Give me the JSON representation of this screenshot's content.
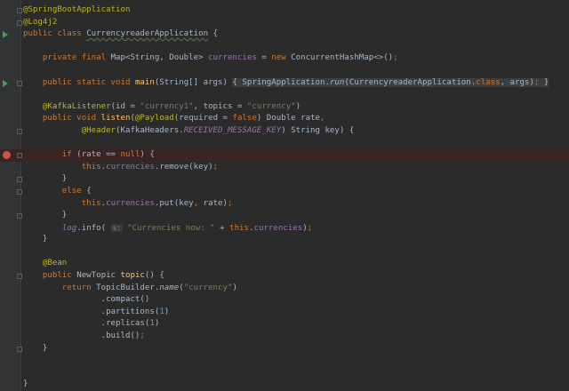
{
  "editor": {
    "colors": {
      "background": "#2b2b2b",
      "keyword": "#cc7832",
      "annotation": "#bbb529",
      "string": "#6a8759",
      "field": "#9876aa",
      "number": "#6897bb",
      "method": "#ffc66d",
      "text": "#a9b7c6",
      "breakpoint": "#c75450",
      "run": "#499c54"
    },
    "lines": [
      {
        "t": [
          [
            "@SpringBootApplication",
            "ann"
          ]
        ],
        "fold": true
      },
      {
        "t": [
          [
            "@Log4j2",
            "ann"
          ]
        ],
        "fold": true
      },
      {
        "t": [
          [
            "public class ",
            "kw"
          ],
          [
            "CurrencyreaderApplication",
            "sq"
          ],
          [
            " {",
            ""
          ]
        ],
        "run": true
      },
      {
        "t": []
      },
      {
        "t": [
          [
            "    private final ",
            "kw"
          ],
          [
            "Map<String, Double> ",
            ""
          ],
          [
            "currencies",
            "field"
          ],
          [
            " = ",
            ""
          ],
          [
            "new ",
            "kw"
          ],
          [
            "ConcurrentHashMap<>()",
            ""
          ],
          [
            ";",
            "kw"
          ]
        ]
      },
      {
        "t": []
      },
      {
        "t": [
          [
            "    public static void ",
            "kw"
          ],
          [
            "main",
            "fn"
          ],
          [
            "(String[] args) ",
            ""
          ],
          [
            "{ SpringApplication.",
            "fold"
          ],
          [
            "run",
            "fold it"
          ],
          [
            "(CurrencyreaderApplication.",
            "fold"
          ],
          [
            "class",
            "fold kw"
          ],
          [
            ", args)",
            "fold"
          ],
          [
            ";",
            "fold kw"
          ],
          [
            " }",
            "fold"
          ]
        ],
        "run": true,
        "fold": true
      },
      {
        "t": []
      },
      {
        "t": [
          [
            "    @KafkaListener",
            "ann"
          ],
          [
            "(id = ",
            ""
          ],
          [
            "\"currency1\"",
            "str"
          ],
          [
            ", topics = ",
            ""
          ],
          [
            "\"currency\"",
            "str"
          ],
          [
            ")",
            ""
          ]
        ]
      },
      {
        "t": [
          [
            "    public void ",
            "kw"
          ],
          [
            "listen",
            "fn"
          ],
          [
            "(",
            ""
          ],
          [
            "@Payload",
            "ann"
          ],
          [
            "(required = ",
            ""
          ],
          [
            "false",
            "kw"
          ],
          [
            ") Double rate",
            ""
          ],
          [
            ",",
            "kw"
          ]
        ]
      },
      {
        "t": [
          [
            "            @Header",
            "ann"
          ],
          [
            "(KafkaHeaders.",
            ""
          ],
          [
            "RECEIVED_MESSAGE_KEY",
            "itf"
          ],
          [
            ") String key) {",
            ""
          ]
        ],
        "fold": true
      },
      {
        "t": []
      },
      {
        "t": [
          [
            "        if ",
            "kw"
          ],
          [
            "(rate == ",
            ""
          ],
          [
            "null",
            "kw"
          ],
          [
            ") {",
            ""
          ]
        ],
        "bp": true,
        "fold": true
      },
      {
        "t": [
          [
            "            this",
            "kw"
          ],
          [
            ".",
            ""
          ],
          [
            "currencies",
            "field"
          ],
          [
            ".remove(key)",
            ""
          ],
          [
            ";",
            "kw"
          ]
        ]
      },
      {
        "t": [
          [
            "        }",
            ""
          ]
        ],
        "fold": true
      },
      {
        "t": [
          [
            "        else ",
            "kw"
          ],
          [
            "{",
            ""
          ]
        ],
        "fold": true
      },
      {
        "t": [
          [
            "            this",
            "kw"
          ],
          [
            ".",
            ""
          ],
          [
            "currencies",
            "field"
          ],
          [
            ".put(key",
            ""
          ],
          [
            ",",
            "kw"
          ],
          [
            " rate)",
            ""
          ],
          [
            ";",
            "kw"
          ]
        ]
      },
      {
        "t": [
          [
            "        }",
            ""
          ]
        ],
        "fold": true
      },
      {
        "t": [
          [
            "        ",
            ""
          ],
          [
            "log",
            "itf"
          ],
          [
            ".info( ",
            ""
          ],
          [
            "s:",
            "hint"
          ],
          [
            " ",
            ""
          ],
          [
            "\"Currencies now: \"",
            "str"
          ],
          [
            " + ",
            ""
          ],
          [
            "this",
            "kw"
          ],
          [
            ".",
            ""
          ],
          [
            "currencies",
            "field"
          ],
          [
            ")",
            ""
          ],
          [
            ";",
            "kw"
          ]
        ]
      },
      {
        "t": [
          [
            "    }",
            ""
          ]
        ]
      },
      {
        "t": []
      },
      {
        "t": [
          [
            "    @Bean",
            "ann"
          ]
        ]
      },
      {
        "t": [
          [
            "    public ",
            "kw"
          ],
          [
            "NewTopic ",
            ""
          ],
          [
            "topic",
            "fn"
          ],
          [
            "() {",
            ""
          ]
        ],
        "fold": true
      },
      {
        "t": [
          [
            "        return ",
            "kw"
          ],
          [
            "TopicBuilder.",
            ""
          ],
          [
            "name",
            "it"
          ],
          [
            "(",
            ""
          ],
          [
            "\"currency\"",
            "str"
          ],
          [
            ")",
            ""
          ]
        ]
      },
      {
        "t": [
          [
            "                .compact()",
            ""
          ]
        ]
      },
      {
        "t": [
          [
            "                .partitions(",
            ""
          ],
          [
            "1",
            "num"
          ],
          [
            ")",
            ""
          ]
        ]
      },
      {
        "t": [
          [
            "                .replicas(",
            ""
          ],
          [
            "1",
            "num"
          ],
          [
            ")",
            ""
          ]
        ]
      },
      {
        "t": [
          [
            "                .build()",
            ""
          ],
          [
            ";",
            "kw"
          ]
        ]
      },
      {
        "t": [
          [
            "    }",
            ""
          ]
        ],
        "fold": true
      },
      {
        "t": []
      },
      {
        "t": []
      },
      {
        "t": [
          [
            "}",
            ""
          ]
        ]
      }
    ]
  }
}
